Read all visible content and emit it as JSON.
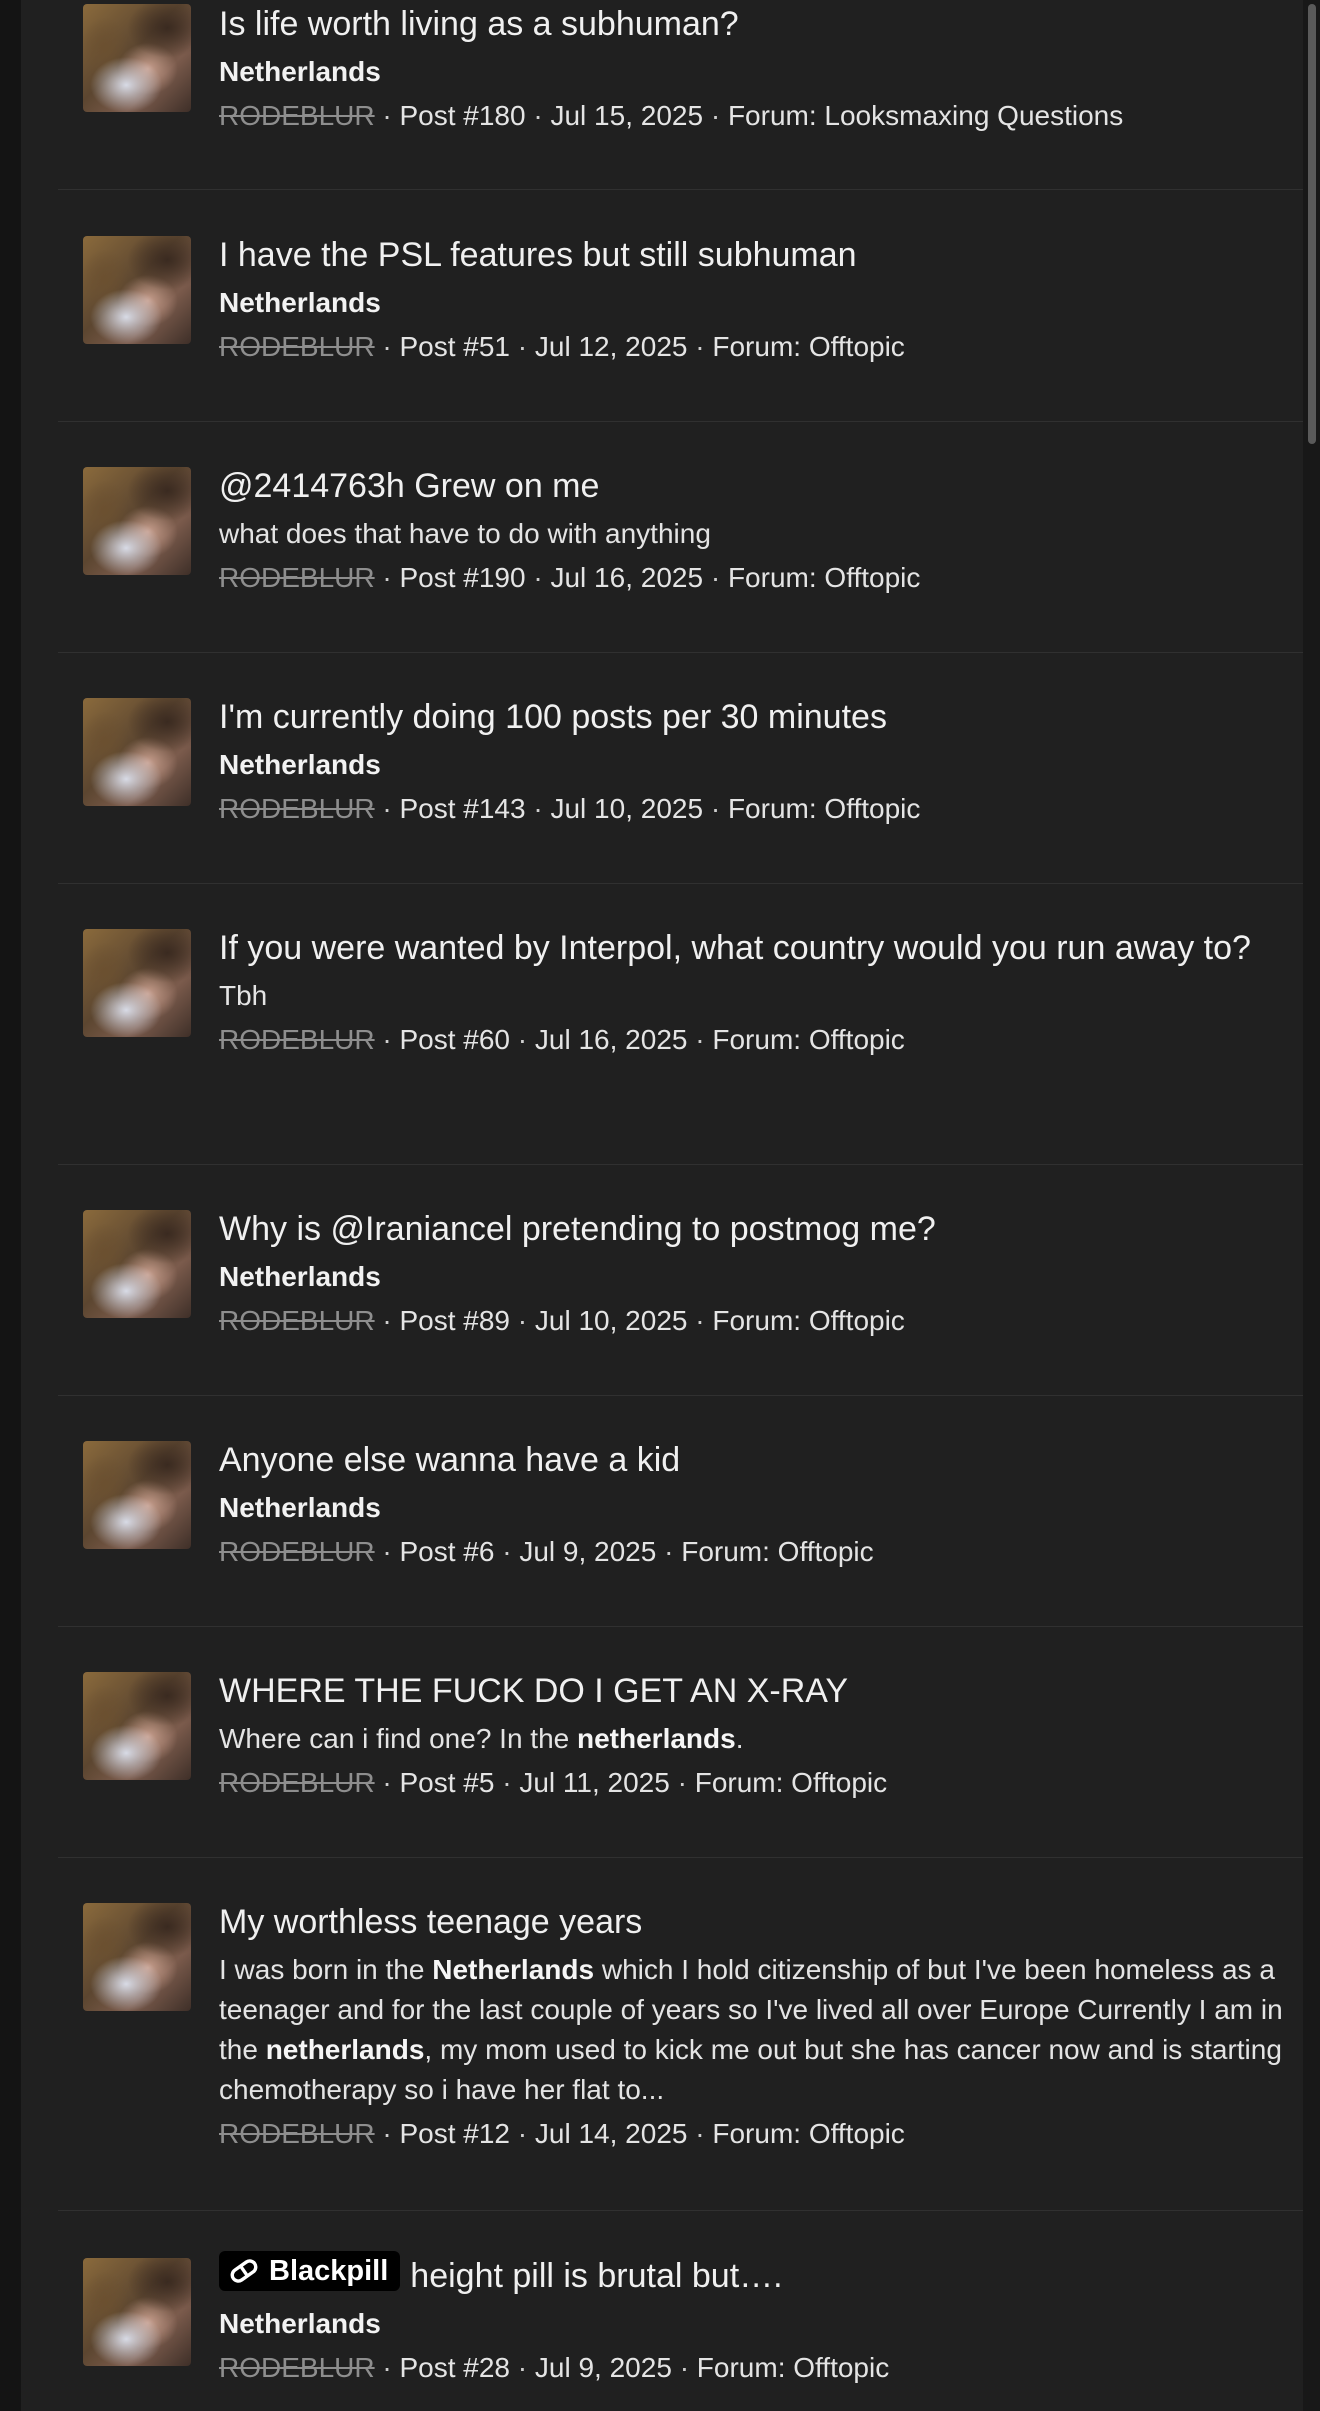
{
  "results": [
    {
      "title": "Is life worth living as a subhuman?",
      "snippet": "Netherlands",
      "username": "RODEBLUR",
      "post": "Post #180",
      "date": "Jul 15, 2025",
      "forum": "Forum: Looksmaxing Questions"
    },
    {
      "title": "I have the PSL features but still subhuman",
      "snippet": "Netherlands",
      "username": "RODEBLUR",
      "post": "Post #51",
      "date": "Jul 12, 2025",
      "forum": "Forum: Offtopic"
    },
    {
      "title": "@2414763h Grew on me",
      "snippet": "what does that have to do with anything",
      "username": "RODEBLUR",
      "post": "Post #190",
      "date": "Jul 16, 2025",
      "forum": "Forum: Offtopic"
    },
    {
      "title": "I'm currently doing 100 posts per 30 minutes",
      "snippet": "Netherlands",
      "username": "RODEBLUR",
      "post": "Post #143",
      "date": "Jul 10, 2025",
      "forum": "Forum: Offtopic"
    },
    {
      "title": "If you were wanted by Interpol, what country would you run away to?",
      "snippet": "Tbh",
      "username": "RODEBLUR",
      "post": "Post #60",
      "date": "Jul 16, 2025",
      "forum": "Forum: Offtopic"
    },
    {
      "title": "Why is @Iraniancel pretending to postmog me?",
      "snippet": "Netherlands",
      "username": "RODEBLUR",
      "post": "Post #89",
      "date": "Jul 10, 2025",
      "forum": "Forum: Offtopic"
    },
    {
      "title": "Anyone else wanna have a kid",
      "snippet": "Netherlands",
      "username": "RODEBLUR",
      "post": "Post #6",
      "date": "Jul 9, 2025",
      "forum": "Forum: Offtopic"
    },
    {
      "title": "WHERE THE FUCK DO I GET AN X-RAY",
      "snippet_parts": [
        "Where can i find one? In the ",
        "netherlands",
        "."
      ],
      "username": "RODEBLUR",
      "post": "Post #5",
      "date": "Jul 11, 2025",
      "forum": "Forum: Offtopic"
    },
    {
      "title": "My worthless teenage years",
      "snippet_parts": [
        "I was born in the ",
        "Netherlands",
        " which I hold citizenship of but I've been homeless as a teenager and for the last couple of years so I've lived all over Europe Currently I am in the ",
        "netherlands",
        ", my mom used to kick me out but she has cancer now and is starting chemotherapy so i have her flat to..."
      ],
      "username": "RODEBLUR",
      "post": "Post #12",
      "date": "Jul 14, 2025",
      "forum": "Forum: Offtopic"
    },
    {
      "label": "Blackpill",
      "label_icon": "blackpill-icon",
      "title": "height pill is brutal but….",
      "snippet": "Netherlands",
      "username": "RODEBLUR",
      "post": "Post #28",
      "date": "Jul 9, 2025",
      "forum": "Forum: Offtopic"
    }
  ],
  "separator": "·"
}
